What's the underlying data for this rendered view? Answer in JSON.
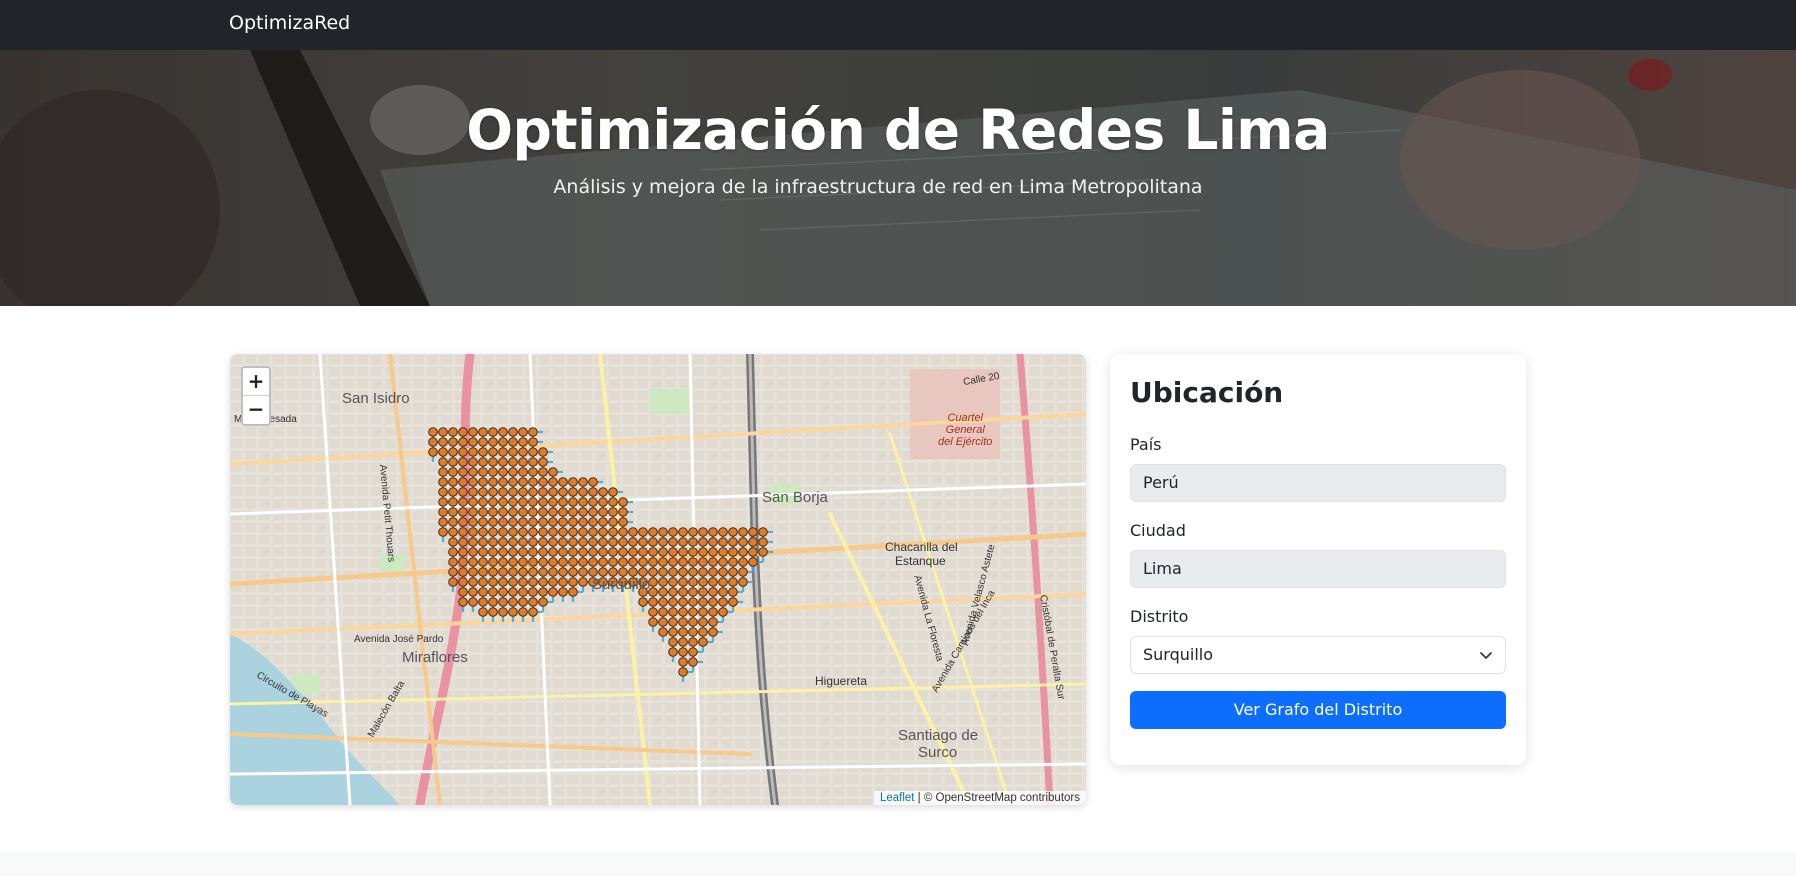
{
  "navbar": {
    "brand": "OptimizaRed"
  },
  "hero": {
    "title": "Optimización de Redes Lima",
    "subtitle": "Análisis y mejora de la infraestructura de red en Lima Metropolitana"
  },
  "map": {
    "zoom_in": "+",
    "zoom_out": "−",
    "attribution_link": "Leaflet",
    "attribution_text": " | © OpenStreetMap contributors",
    "labels": {
      "san_isidro": "San Isidro",
      "miro_quesada": "Miro Quesada",
      "san_borja": "San Borja",
      "surquillo": "Surquillo",
      "chacarilla": "Chacarilla del",
      "estanque": "Estanque",
      "miraflores": "Miraflores",
      "higuereta": "Higuereta",
      "santiago": "Santiago de",
      "surco": "Surco",
      "cuartel": "Cuartel",
      "general": "General",
      "ejercito": "del Ejército",
      "calle20": "Calle 20",
      "av_jose_pardo": "Avenida José Pardo",
      "av_petit_thouars": "Avenida Petit Thouars",
      "circuito_playas": "Circuito de Playas",
      "malecon_balta": "Malecón Balta",
      "av_la_floresta": "Avenida La Floresta",
      "av_velasco_astete": "Avenida Velasco Astete",
      "av_caminos_inca": "Avenida Caminos del Inca",
      "cristobal_peralta": "Cristóbal de Peralta Sur"
    },
    "colors": {
      "node_fill": "#e07b2a",
      "node_stroke": "#4a2a10",
      "edge": "#3aa8d8"
    }
  },
  "form": {
    "title": "Ubicación",
    "pais_label": "País",
    "pais_value": "Perú",
    "ciudad_label": "Ciudad",
    "ciudad_value": "Lima",
    "distrito_label": "Distrito",
    "distrito_value": "Surquillo",
    "button_label": "Ver Grafo del Distrito"
  },
  "colors": {
    "primary": "#0d6efd",
    "navbar": "#212529"
  }
}
